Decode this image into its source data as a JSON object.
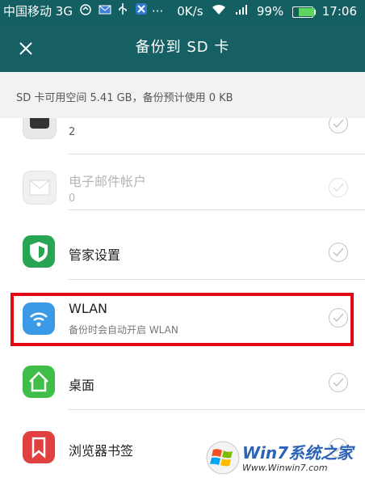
{
  "status_bar": {
    "carrier": "中国移动",
    "network": "3G",
    "more": "···",
    "speed": "0K/s",
    "signal_tag": "3G",
    "battery": "99%",
    "time": "17:06"
  },
  "app_bar": {
    "title": "备份到 SD 卡"
  },
  "info": {
    "text": "SD 卡可用空间 5.41 GB，备份预计使用 0 KB"
  },
  "items": [
    {
      "label": "",
      "sub": "2",
      "icon": "clock-app-icon"
    },
    {
      "label": "电子邮件帐户",
      "sub": "0",
      "icon": "email-icon"
    },
    {
      "label": "管家设置",
      "sub": "",
      "icon": "shield-icon"
    },
    {
      "label": "WLAN",
      "sub": "备份时会自动开启 WLAN",
      "icon": "wifi-icon"
    },
    {
      "label": "桌面",
      "sub": "",
      "icon": "home-icon"
    },
    {
      "label": "浏览器书签",
      "sub": "",
      "icon": "bookmark-icon"
    }
  ],
  "watermark": {
    "title": "Win7系统之家",
    "url": "Www.Winwin7.com"
  },
  "colors": {
    "header": "#165f62",
    "highlight": "#e30914",
    "wlan_icon": "#3a9ae8",
    "shield_icon": "#27a552",
    "home_icon": "#3fbf4a",
    "bookmark_icon": "#e04040"
  }
}
